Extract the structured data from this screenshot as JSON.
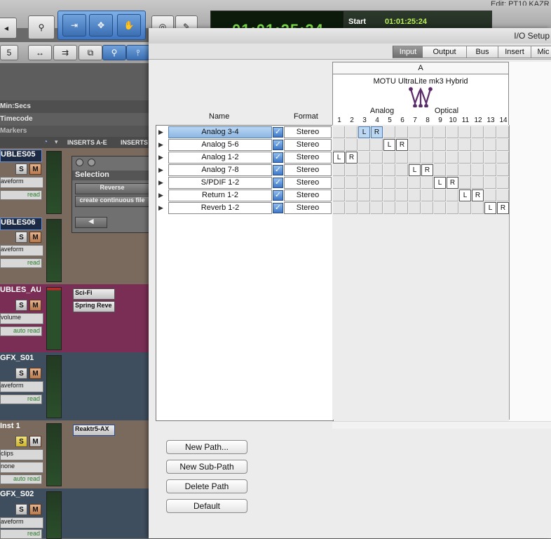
{
  "background": {
    "top_counter_main": "01:01:25:24",
    "start_label": "Start",
    "start_value": "01:01:25:24",
    "edit_window_label": "Edit: PT10 KAZR",
    "toolbar_num": "5",
    "rulers": [
      "Min:Secs",
      "Timecode",
      "Markers"
    ],
    "inserts_header": "INSERTS A-E",
    "inserts_header2": "INSERTS",
    "tracks": [
      {
        "name": "UBLES05",
        "solo": "S",
        "mute": "M",
        "view": "aveform",
        "auto": "read"
      },
      {
        "name": "UBLES06",
        "solo": "S",
        "mute": "M",
        "view": "aveform",
        "auto": "read"
      },
      {
        "name": "UBLES_AU",
        "solo": "S",
        "mute": "M",
        "view": "volume",
        "auto": "auto read",
        "plugins": [
          "Sci-Fi",
          "Spring Reve"
        ]
      },
      {
        "name": "GFX_S01",
        "solo": "S",
        "mute": "M",
        "view": "aveform",
        "auto": "read"
      },
      {
        "name": "Inst 1",
        "solo": "S",
        "mute": "M",
        "view": "clips",
        "view2": "none",
        "auto": "auto read",
        "plugins": [
          "Reaktr5-AX"
        ]
      },
      {
        "name": "GFX_S02",
        "solo": "S",
        "mute": "M",
        "view": "aveform",
        "auto": "read"
      }
    ],
    "selection_window": {
      "title": "Selection",
      "buttons": [
        "Reverse",
        "create continuous file"
      ]
    }
  },
  "io_setup": {
    "title": "I/O Setup",
    "tabs": [
      "Input",
      "Output",
      "Bus",
      "Insert",
      "Mic"
    ],
    "active_tab": "Input",
    "columns": {
      "name": "Name",
      "format": "Format"
    },
    "device_letter": "A",
    "device_name": "MOTU UltraLite mk3 Hybrid",
    "groups": [
      "Analog",
      "Optical"
    ],
    "channel_numbers": [
      "1",
      "2",
      "3",
      "4",
      "5",
      "6",
      "7",
      "8",
      "9",
      "10",
      "11",
      "12",
      "13",
      "14"
    ],
    "paths": [
      {
        "name": "Analog 3-4",
        "format": "Stereo",
        "selected": true,
        "L": 3,
        "R": 4
      },
      {
        "name": "Analog 5-6",
        "format": "Stereo",
        "selected": false,
        "L": 5,
        "R": 6
      },
      {
        "name": "Analog 1-2",
        "format": "Stereo",
        "selected": false,
        "L": 1,
        "R": 2
      },
      {
        "name": "Analog 7-8",
        "format": "Stereo",
        "selected": false,
        "L": 7,
        "R": 8
      },
      {
        "name": "S/PDIF 1-2",
        "format": "Stereo",
        "selected": false,
        "L": 9,
        "R": 10
      },
      {
        "name": "Return 1-2",
        "format": "Stereo",
        "selected": false,
        "L": 11,
        "R": 12
      },
      {
        "name": "Reverb 1-2",
        "format": "Stereo",
        "selected": false,
        "L": 13,
        "R": 14
      }
    ],
    "buttons": {
      "new_path": "New Path...",
      "new_sub_path": "New Sub-Path",
      "delete_path": "Delete Path",
      "default": "Default"
    }
  }
}
